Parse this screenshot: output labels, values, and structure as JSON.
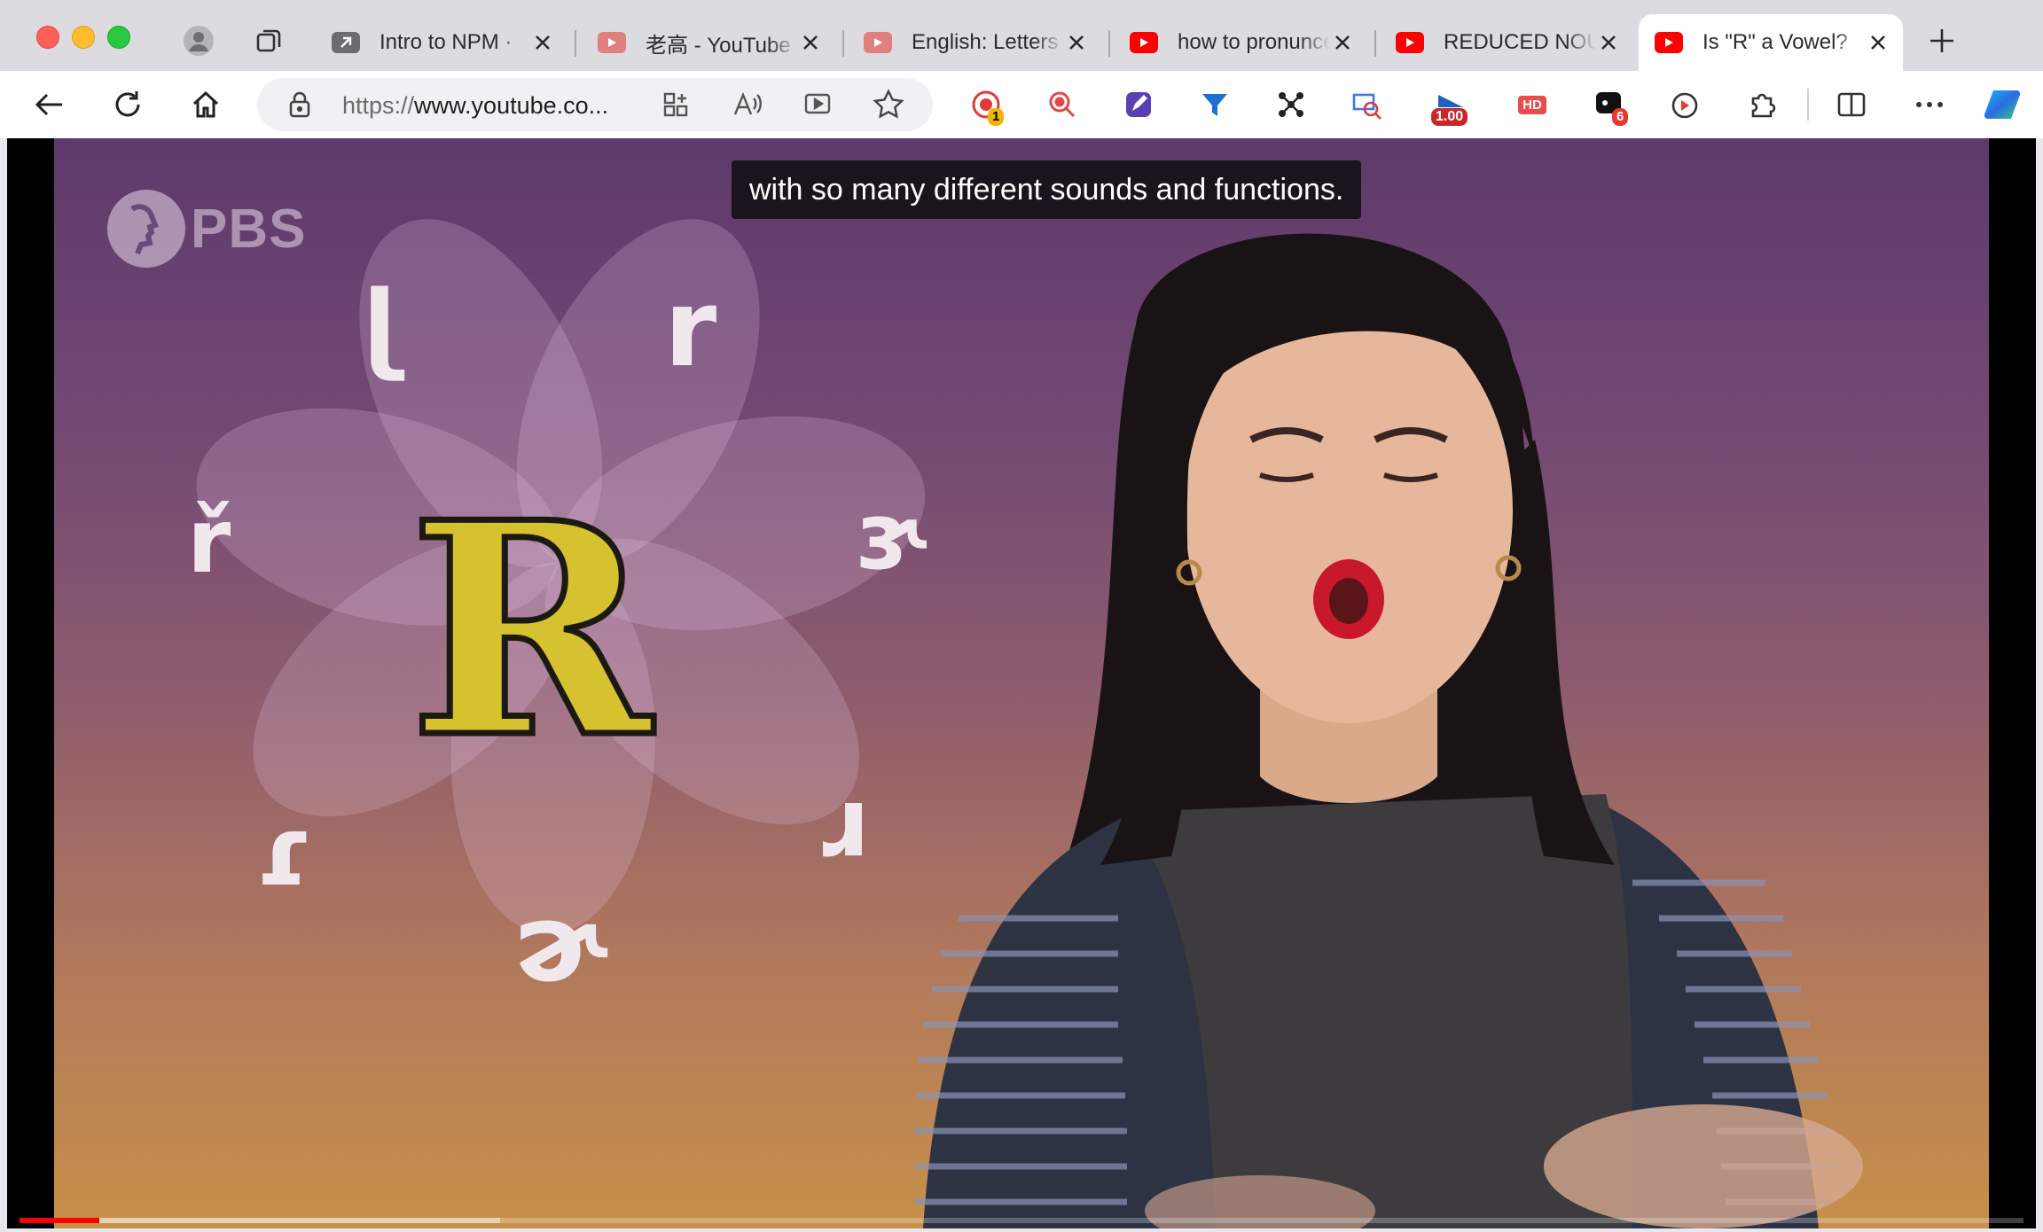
{
  "browser": {
    "tabs": [
      {
        "title": "Intro to NPM ·",
        "favicon": "link-arrow-icon",
        "active": false
      },
      {
        "title": "老高 - YouTube",
        "favicon": "youtube-icon",
        "active": false
      },
      {
        "title": "English: Letters",
        "favicon": "youtube-icon",
        "active": false
      },
      {
        "title": "how to pronunce",
        "favicon": "youtube-icon",
        "active": false
      },
      {
        "title": "REDUCED NOUNS",
        "favicon": "youtube-icon",
        "active": false
      },
      {
        "title": "Is \"R\" a Vowel?",
        "favicon": "youtube-icon",
        "active": true
      }
    ],
    "address": {
      "protocol": "https://",
      "host": "www.youtube.co..."
    },
    "extension_badges": {
      "recorder": "1",
      "speed": "1.00",
      "hd": "HD",
      "notifications": "6"
    }
  },
  "video": {
    "caption": "with so many different sounds and functions.",
    "channel_logo": "PBS",
    "letter": "R",
    "symbols": [
      "ɭ",
      "r",
      "ɝ",
      "ɹ",
      "ɚ",
      "ɾ",
      "ř"
    ],
    "progress": {
      "played_fraction": 0.04,
      "buffered_fraction": 0.24
    },
    "colors": {
      "accent": "#ff0000",
      "letter": "#d6c12e"
    }
  }
}
